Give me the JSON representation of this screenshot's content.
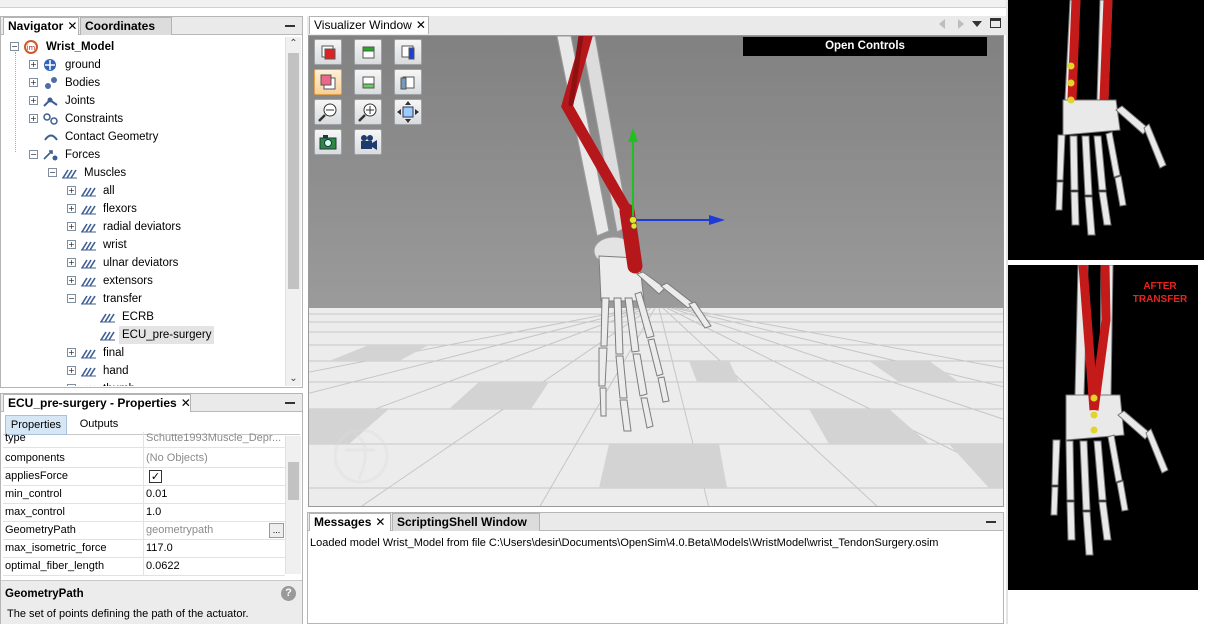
{
  "navigator": {
    "tabs": [
      "Navigator",
      "Coordinates"
    ],
    "tree": [
      {
        "label": "Wrist_Model",
        "level": 0,
        "expander": "−",
        "icon": "model-icon",
        "bold": true
      },
      {
        "label": "ground",
        "level": 1,
        "expander": "+",
        "icon": "ground-icon"
      },
      {
        "label": "Bodies",
        "level": 1,
        "expander": "+",
        "icon": "bodies-icon"
      },
      {
        "label": "Joints",
        "level": 1,
        "expander": "+",
        "icon": "joints-icon"
      },
      {
        "label": "Constraints",
        "level": 1,
        "expander": "+",
        "icon": "constraints-icon"
      },
      {
        "label": "Contact Geometry",
        "level": 1,
        "expander": "",
        "icon": "contact-geometry-icon"
      },
      {
        "label": "Forces",
        "level": 1,
        "expander": "−",
        "icon": "forces-icon"
      },
      {
        "label": "Muscles",
        "level": 2,
        "expander": "−",
        "icon": "muscle-icon"
      },
      {
        "label": "all",
        "level": 3,
        "expander": "+",
        "icon": "muscle-icon"
      },
      {
        "label": "flexors",
        "level": 3,
        "expander": "+",
        "icon": "muscle-icon"
      },
      {
        "label": "radial deviators",
        "level": 3,
        "expander": "+",
        "icon": "muscle-icon"
      },
      {
        "label": "wrist",
        "level": 3,
        "expander": "+",
        "icon": "muscle-icon"
      },
      {
        "label": "ulnar deviators",
        "level": 3,
        "expander": "+",
        "icon": "muscle-icon"
      },
      {
        "label": "extensors",
        "level": 3,
        "expander": "+",
        "icon": "muscle-icon"
      },
      {
        "label": "transfer",
        "level": 3,
        "expander": "−",
        "icon": "muscle-icon"
      },
      {
        "label": "ECRB",
        "level": 4,
        "expander": "",
        "icon": "muscle-icon"
      },
      {
        "label": "ECU_pre-surgery",
        "level": 4,
        "expander": "",
        "icon": "muscle-icon",
        "selected": true
      },
      {
        "label": "final",
        "level": 3,
        "expander": "+",
        "icon": "muscle-icon"
      },
      {
        "label": "hand",
        "level": 3,
        "expander": "+",
        "icon": "muscle-icon"
      },
      {
        "label": "thumb",
        "level": 3,
        "expander": "+",
        "icon": "muscle-icon"
      }
    ]
  },
  "properties": {
    "title": "ECU_pre-surgery - Properties",
    "subtabs": [
      "Properties",
      "Outputs"
    ],
    "rows": [
      {
        "name": "type",
        "value": "Schutte1993Muscle_Depr...",
        "grey": true
      },
      {
        "name": "components",
        "value": "(No Objects)",
        "grey": true
      },
      {
        "name": "appliesForce",
        "value": "",
        "checkbox": true,
        "checked": true
      },
      {
        "name": "min_control",
        "value": "0.01"
      },
      {
        "name": "max_control",
        "value": "1.0"
      },
      {
        "name": "GeometryPath",
        "value": "geometrypath",
        "grey": true,
        "ellipsis": "..."
      },
      {
        "name": "max_isometric_force",
        "value": "117.0"
      },
      {
        "name": "optimal_fiber_length",
        "value": "0.0622"
      }
    ],
    "help_title": "GeometryPath",
    "help_text": "The set of points defining the path of the actuator.",
    "help_icon": "question-icon"
  },
  "visualizer": {
    "tab": "Visualizer Window",
    "open_controls": "Open Controls",
    "toolbar": [
      {
        "name": "front-view-icon"
      },
      {
        "name": "top-view-icon"
      },
      {
        "name": "right-view-icon"
      },
      {
        "name": "back-view-icon",
        "selected": true
      },
      {
        "name": "bottom-view-icon"
      },
      {
        "name": "left-view-icon"
      },
      {
        "name": "zoom-out-icon"
      },
      {
        "name": "zoom-in-icon"
      },
      {
        "name": "fit-view-icon"
      },
      {
        "name": "snapshot-icon"
      },
      {
        "name": "record-movie-icon"
      }
    ],
    "colors": {
      "muscle": "#b5171b",
      "bone": "#e6e6e6",
      "axis_y": "#20c020",
      "axis_x": "#1c3bd8",
      "background": "#8c8c8c"
    }
  },
  "messages": {
    "tabs": [
      "Messages",
      "ScriptingShell Window"
    ],
    "text": "Loaded model Wrist_Model from file C:\\Users\\desir\\Documents\\OpenSim\\4.0.Beta\\Models\\WristModel\\wrist_TendonSurgery.osim"
  },
  "side_images": {
    "after_label": "AFTER\nTRANSFER"
  }
}
